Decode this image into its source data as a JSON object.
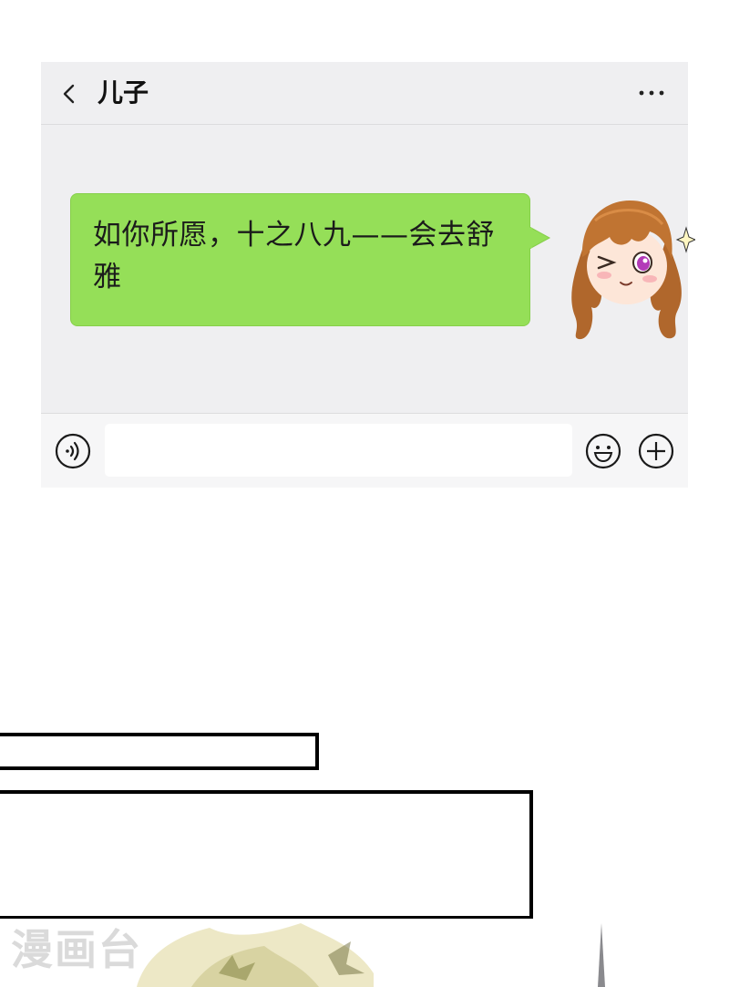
{
  "header": {
    "back_icon": "chevron-left-icon",
    "title": "儿子",
    "more_icon": "more-horizontal-icon"
  },
  "message": {
    "text": "如你所愿，十之八九——会去舒雅",
    "bubble_color": "#95df58",
    "sender_avatar": "anime-girl-winking-avatar"
  },
  "input_bar": {
    "voice_icon": "voice-icon",
    "input_value": "",
    "emoji_icon": "emoji-smile-icon",
    "plus_icon": "plus-circle-icon"
  },
  "watermark": {
    "text": "漫画台"
  },
  "colors": {
    "chat_background": "#efeff1",
    "input_bar_background": "#f6f6f7",
    "panel_border": "#000000"
  }
}
